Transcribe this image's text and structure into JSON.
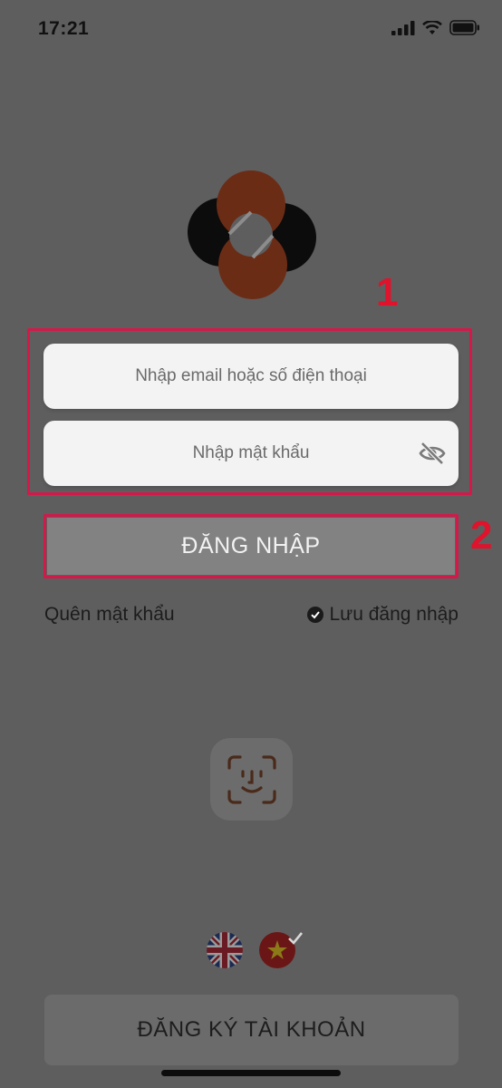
{
  "status_bar": {
    "time": "17:21"
  },
  "login": {
    "email_placeholder": "Nhập email hoặc số điện thoại",
    "password_placeholder": "Nhập mật khẩu",
    "login_button": "ĐĂNG NHẬP",
    "forgot_password": "Quên mật khẩu",
    "remember_login": "Lưu đăng nhập",
    "remember_checked": true
  },
  "annotations": {
    "marker_1": "1",
    "marker_2": "2",
    "color": "#d3194a"
  },
  "languages": [
    {
      "icon": "uk-flag-icon",
      "selected": false
    },
    {
      "icon": "vietnam-flag-icon",
      "selected": true
    }
  ],
  "register_button": "ĐĂNG KÝ TÀI KHOẢN",
  "icons": [
    "signal-icon",
    "wifi-icon",
    "battery-icon",
    "app-logo",
    "eye-off-icon",
    "check-circle-icon",
    "face-id-icon"
  ]
}
